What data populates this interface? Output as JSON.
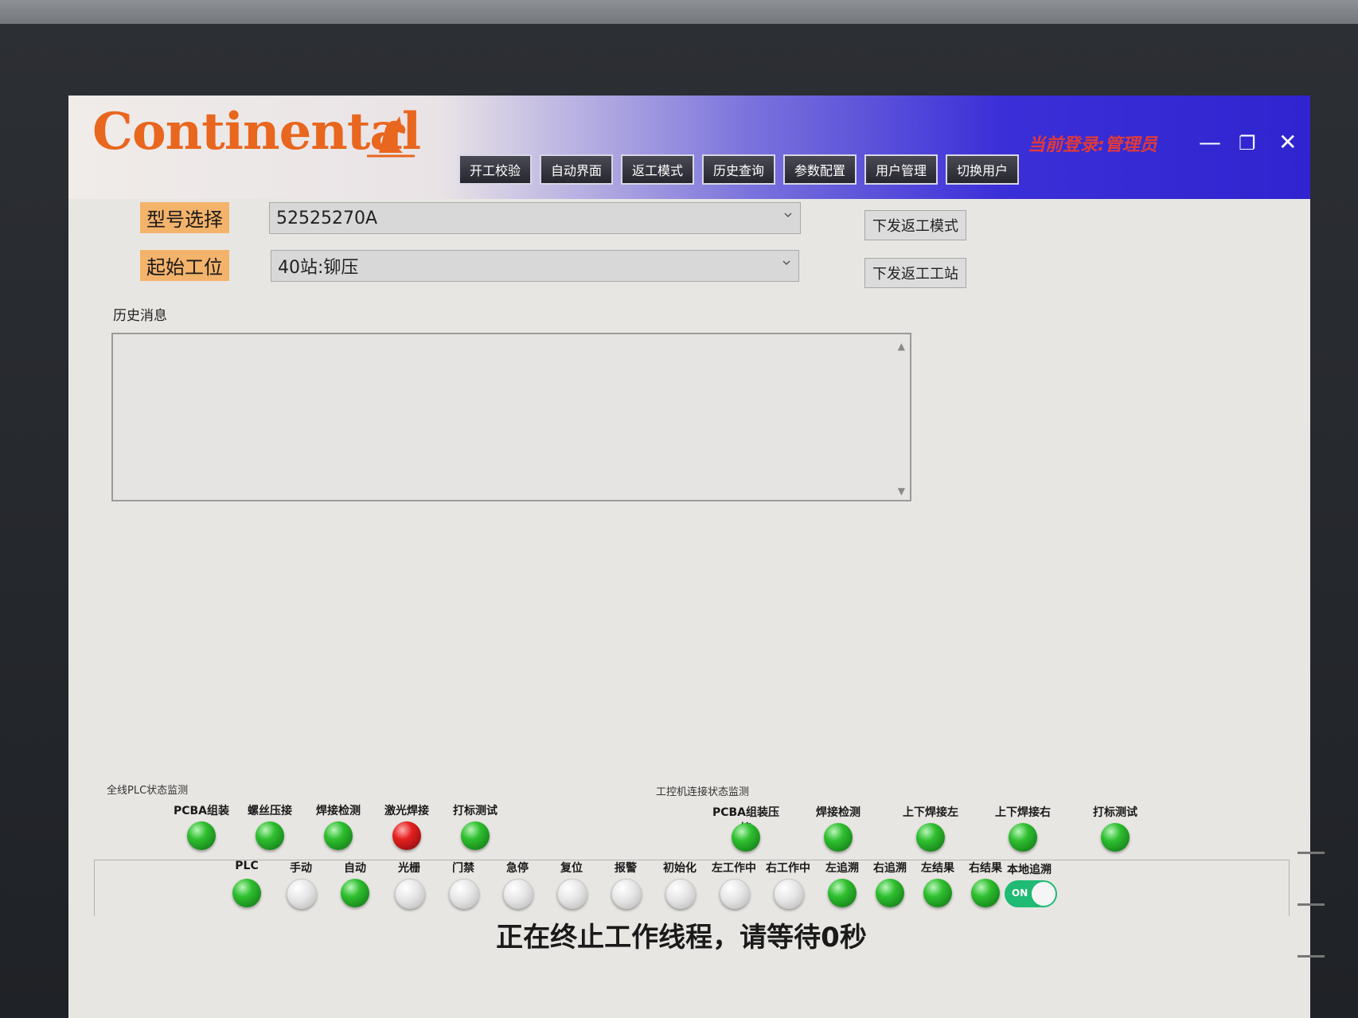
{
  "app": {
    "logo_text": "Continental",
    "login_status": "当前登录:管理员"
  },
  "nav": {
    "items": [
      "开工校验",
      "自动界面",
      "返工模式",
      "历史查询",
      "参数配置",
      "用户管理",
      "切换用户"
    ]
  },
  "window_controls": {
    "minimize": "—",
    "maximize": "❐",
    "close": "✕"
  },
  "form": {
    "model_label": "型号选择",
    "model_value": "52525270A",
    "station_label": "起始工位",
    "station_value": "40站:铆压",
    "send_mode_button": "下发返工模式",
    "send_station_button": "下发返工工站"
  },
  "history": {
    "label": "历史消息",
    "content": ""
  },
  "plc_monitor": {
    "title": "全线PLC状态监测",
    "stations": [
      {
        "label": "PCBA组装",
        "status": "green"
      },
      {
        "label": "螺丝压接",
        "status": "green"
      },
      {
        "label": "焊接检测",
        "status": "green"
      },
      {
        "label": "激光焊接",
        "status": "red"
      },
      {
        "label": "打标测试",
        "status": "green"
      }
    ]
  },
  "ipc_monitor": {
    "title": "工控机连接状态监测",
    "stations": [
      {
        "label": "PCBA组装压接",
        "status": "green"
      },
      {
        "label": "焊接检测",
        "status": "green"
      },
      {
        "label": "上下焊接左",
        "status": "green"
      },
      {
        "label": "上下焊接右",
        "status": "green"
      },
      {
        "label": "打标测试",
        "status": "green"
      }
    ]
  },
  "signals": [
    {
      "label": "PLC",
      "status": "green"
    },
    {
      "label": "手动",
      "status": "off"
    },
    {
      "label": "自动",
      "status": "green"
    },
    {
      "label": "光栅",
      "status": "off"
    },
    {
      "label": "门禁",
      "status": "off"
    },
    {
      "label": "急停",
      "status": "off"
    },
    {
      "label": "复位",
      "status": "off"
    },
    {
      "label": "报警",
      "status": "off"
    },
    {
      "label": "初始化",
      "status": "off"
    },
    {
      "label": "左工作中",
      "status": "off"
    },
    {
      "label": "右工作中",
      "status": "off"
    },
    {
      "label": "左追溯",
      "status": "green"
    },
    {
      "label": "右追溯",
      "status": "green"
    },
    {
      "label": "左结果",
      "status": "green"
    },
    {
      "label": "右结果",
      "status": "green"
    }
  ],
  "local_trace": {
    "label": "本地追溯",
    "toggle_text": "ON"
  },
  "status_message": "正在终止工作线程，请等待0秒",
  "colors": {
    "accent_orange": "#e8661e",
    "titlebar_blue": "#2f24cf",
    "label_tag": "#f4b36b",
    "led_green": "#2fbf2f",
    "led_red": "#e52020",
    "toggle_on": "#1fba73"
  }
}
